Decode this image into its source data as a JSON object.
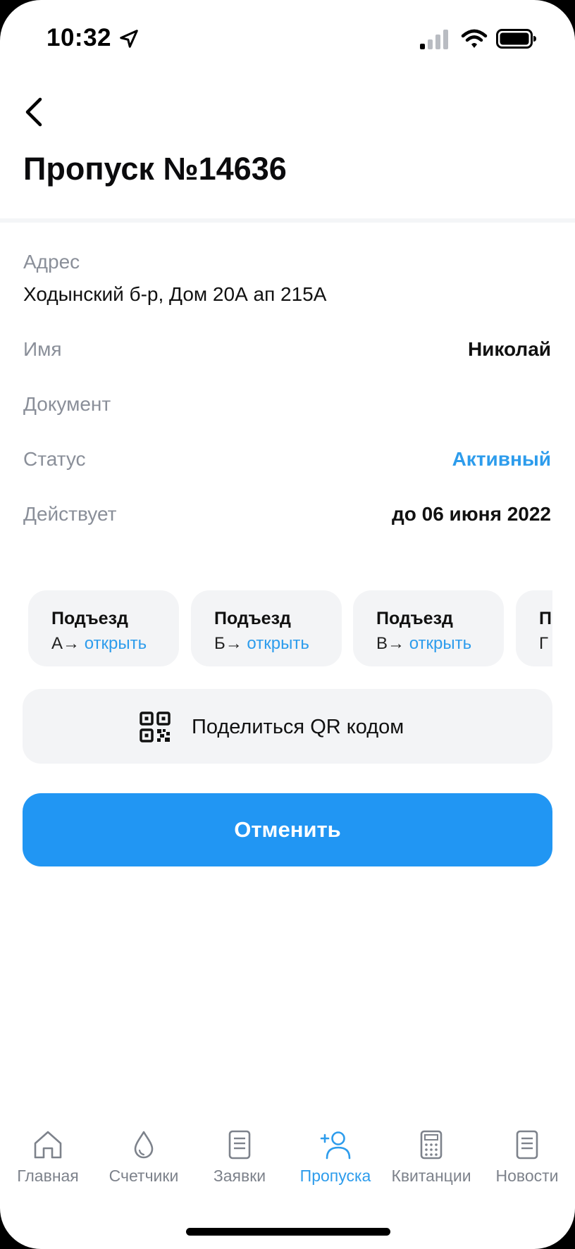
{
  "status_bar": {
    "time": "10:32"
  },
  "header": {
    "title": "Пропуск №14636"
  },
  "details": {
    "address_label": "Адрес",
    "address_value": "Ходынский б-р, Дом 20А ап 215А",
    "name_label": "Имя",
    "name_value": "Николай",
    "document_label": "Документ",
    "status_label": "Статус",
    "status_value": "Активный",
    "valid_label": "Действует",
    "valid_value": "до 06 июня 2022"
  },
  "entrances": [
    {
      "title": "Подъезд",
      "letter": "А",
      "arrow": "→",
      "action": "открыть"
    },
    {
      "title": "Подъезд",
      "letter": "Б",
      "arrow": "→",
      "action": "открыть"
    },
    {
      "title": "Подъезд",
      "letter": "В",
      "arrow": "→",
      "action": "открыть"
    },
    {
      "title": "П",
      "letter": "Г",
      "arrow": "",
      "action": ""
    }
  ],
  "share": {
    "label": "Поделиться QR кодом",
    "icon": "qr-code-icon"
  },
  "cancel": {
    "label": "Отменить"
  },
  "tabbar": {
    "items": [
      {
        "label": "Главная",
        "icon": "home-icon"
      },
      {
        "label": "Счетчики",
        "icon": "drop-icon"
      },
      {
        "label": "Заявки",
        "icon": "document-icon"
      },
      {
        "label": "Пропуска",
        "icon": "add-person-icon",
        "active": true
      },
      {
        "label": "Квитанции",
        "icon": "calculator-icon"
      },
      {
        "label": "Новости",
        "icon": "news-icon"
      }
    ]
  },
  "colors": {
    "accent": "#2d9cec",
    "button": "#2196f3",
    "label_gray": "#8a8f99",
    "card_bg": "#f3f4f6"
  }
}
